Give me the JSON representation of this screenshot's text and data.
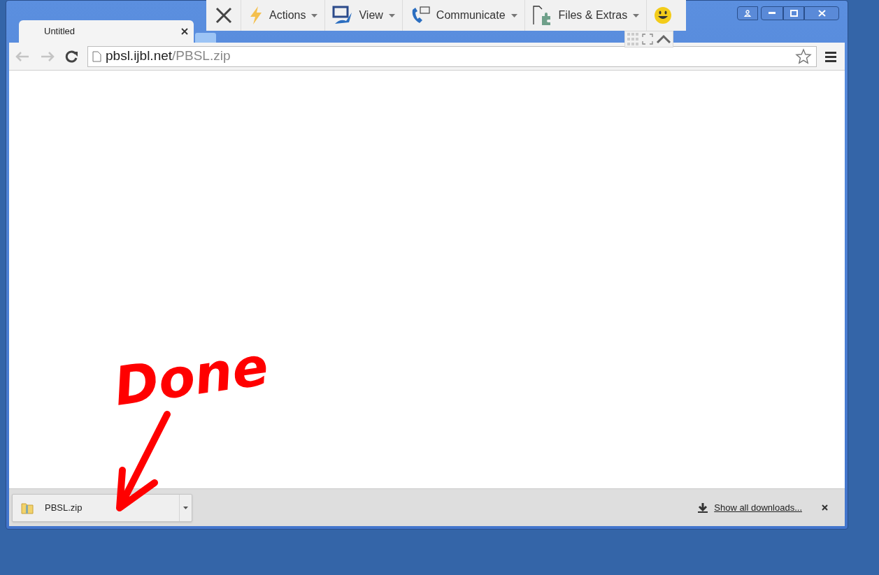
{
  "remote_toolbar": {
    "menus": [
      {
        "label": "Actions",
        "kind": "lightning"
      },
      {
        "label": "View",
        "kind": "monitor"
      },
      {
        "label": "Communicate",
        "kind": "phone"
      },
      {
        "label": "Files & Extras",
        "kind": "puzzle"
      }
    ]
  },
  "tabs": [
    {
      "label": "Untitled",
      "selected": true
    }
  ],
  "address_bar": {
    "host": "pbsl.ijbl.net",
    "path": "/PBSL.zip"
  },
  "annotation": {
    "text": "Done"
  },
  "download_bar": {
    "items": [
      {
        "name": "PBSL.zip"
      }
    ],
    "show_all": "Show all downloads..."
  }
}
